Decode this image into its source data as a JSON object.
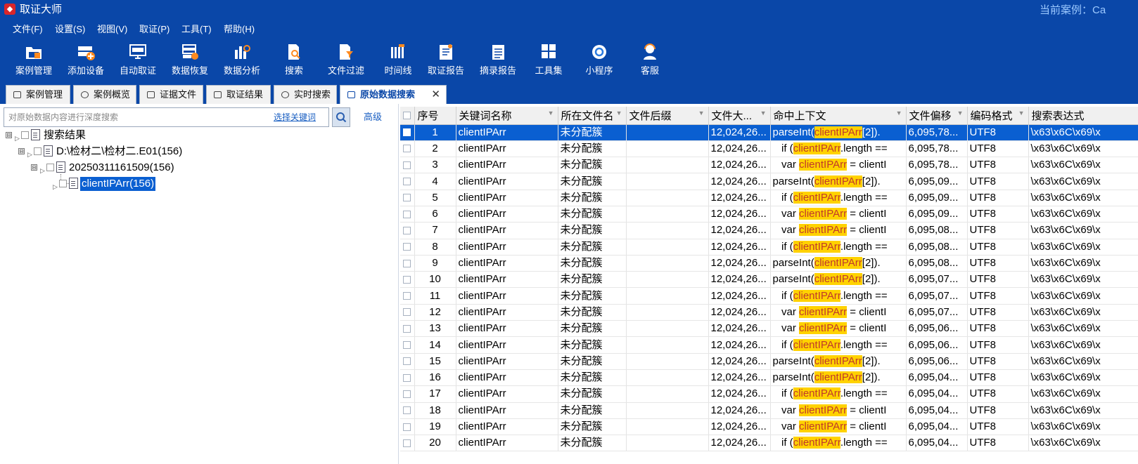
{
  "app": {
    "title": "取证大师",
    "logo": "◆",
    "case_label": "当前案例：Ca"
  },
  "menu": [
    "文件(F)",
    "设置(S)",
    "视图(V)",
    "取证(P)",
    "工具(T)",
    "帮助(H)"
  ],
  "toolbar": [
    {
      "label": "案例管理",
      "icon": "folder-case-icon"
    },
    {
      "label": "添加设备",
      "icon": "add-device-icon"
    },
    {
      "label": "自动取证",
      "icon": "auto-monitor-icon"
    },
    {
      "label": "数据恢复",
      "icon": "data-recovery-icon"
    },
    {
      "label": "数据分析",
      "icon": "data-analysis-icon"
    },
    {
      "label": "搜索",
      "icon": "search-doc-icon"
    },
    {
      "label": "文件过滤",
      "icon": "file-filter-icon"
    },
    {
      "label": "时间线",
      "icon": "timeline-icon"
    },
    {
      "label": "取证报告",
      "icon": "report-icon"
    },
    {
      "label": "摘录报告",
      "icon": "excerpt-report-icon"
    },
    {
      "label": "工具集",
      "icon": "toolset-grid-icon"
    },
    {
      "label": "小程序",
      "icon": "mini-program-icon"
    },
    {
      "label": "客服",
      "icon": "support-agent-icon"
    }
  ],
  "tabs": [
    {
      "label": "案例管理"
    },
    {
      "label": "案例概览"
    },
    {
      "label": "证据文件"
    },
    {
      "label": "取证结果"
    },
    {
      "label": "实时搜索"
    },
    {
      "label": "原始数据搜索",
      "active": true,
      "close": "✕"
    }
  ],
  "search": {
    "placeholder": "对原始数据内容进行深度搜索",
    "keyword_link": "选择关键词",
    "advanced": "高级"
  },
  "tree": [
    {
      "label": "搜索结果",
      "exp": "⊟"
    },
    {
      "label": "D:\\检材二\\检材二.E01(156)",
      "exp": "⊟"
    },
    {
      "label": "20250311161509(156)",
      "exp": "⊟"
    },
    {
      "label": "clientIPArr(156)",
      "selected": true
    }
  ],
  "grid": {
    "columns": [
      "序号",
      "关键词名称",
      "所在文件名",
      "文件后缀",
      "文件大...",
      "命中上下文",
      "文件偏移",
      "编码格式",
      "搜索表达式"
    ],
    "keyword": "clientIPArr",
    "rows": [
      {
        "n": "1",
        "kw": "clientIPArr",
        "file": "未分配簇",
        "ext": "",
        "size": "12,024,26...",
        "pre": "parseInt(",
        "post": "[2]).",
        "off": "6,095,78...",
        "enc": "UTF8",
        "expr": "\\x63\\x6C\\x69\\x"
      },
      {
        "n": "2",
        "kw": "clientIPArr",
        "file": "未分配簇",
        "ext": "",
        "size": "12,024,26...",
        "pre": "   if (",
        "post": ".length ==",
        "off": "6,095,78...",
        "enc": "UTF8",
        "expr": "\\x63\\x6C\\x69\\x"
      },
      {
        "n": "3",
        "kw": "clientIPArr",
        "file": "未分配簇",
        "ext": "",
        "size": "12,024,26...",
        "pre": "   var ",
        "post": " = clientI",
        "off": "6,095,78...",
        "enc": "UTF8",
        "expr": "\\x63\\x6C\\x69\\x"
      },
      {
        "n": "4",
        "kw": "clientIPArr",
        "file": "未分配簇",
        "ext": "",
        "size": "12,024,26...",
        "pre": "parseInt(",
        "post": "[2]).",
        "off": "6,095,09...",
        "enc": "UTF8",
        "expr": "\\x63\\x6C\\x69\\x"
      },
      {
        "n": "5",
        "kw": "clientIPArr",
        "file": "未分配簇",
        "ext": "",
        "size": "12,024,26...",
        "pre": "   if (",
        "post": ".length ==",
        "off": "6,095,09...",
        "enc": "UTF8",
        "expr": "\\x63\\x6C\\x69\\x"
      },
      {
        "n": "6",
        "kw": "clientIPArr",
        "file": "未分配簇",
        "ext": "",
        "size": "12,024,26...",
        "pre": "   var ",
        "post": " = clientI",
        "off": "6,095,09...",
        "enc": "UTF8",
        "expr": "\\x63\\x6C\\x69\\x"
      },
      {
        "n": "7",
        "kw": "clientIPArr",
        "file": "未分配簇",
        "ext": "",
        "size": "12,024,26...",
        "pre": "   var ",
        "post": " = clientI",
        "off": "6,095,08...",
        "enc": "UTF8",
        "expr": "\\x63\\x6C\\x69\\x"
      },
      {
        "n": "8",
        "kw": "clientIPArr",
        "file": "未分配簇",
        "ext": "",
        "size": "12,024,26...",
        "pre": "   if (",
        "post": ".length ==",
        "off": "6,095,08...",
        "enc": "UTF8",
        "expr": "\\x63\\x6C\\x69\\x"
      },
      {
        "n": "9",
        "kw": "clientIPArr",
        "file": "未分配簇",
        "ext": "",
        "size": "12,024,26...",
        "pre": "parseInt(",
        "post": "[2]).",
        "off": "6,095,08...",
        "enc": "UTF8",
        "expr": "\\x63\\x6C\\x69\\x"
      },
      {
        "n": "10",
        "kw": "clientIPArr",
        "file": "未分配簇",
        "ext": "",
        "size": "12,024,26...",
        "pre": "parseInt(",
        "post": "[2]).",
        "off": "6,095,07...",
        "enc": "UTF8",
        "expr": "\\x63\\x6C\\x69\\x"
      },
      {
        "n": "11",
        "kw": "clientIPArr",
        "file": "未分配簇",
        "ext": "",
        "size": "12,024,26...",
        "pre": "   if (",
        "post": ".length ==",
        "off": "6,095,07...",
        "enc": "UTF8",
        "expr": "\\x63\\x6C\\x69\\x"
      },
      {
        "n": "12",
        "kw": "clientIPArr",
        "file": "未分配簇",
        "ext": "",
        "size": "12,024,26...",
        "pre": "   var ",
        "post": " = clientI",
        "off": "6,095,07...",
        "enc": "UTF8",
        "expr": "\\x63\\x6C\\x69\\x"
      },
      {
        "n": "13",
        "kw": "clientIPArr",
        "file": "未分配簇",
        "ext": "",
        "size": "12,024,26...",
        "pre": "   var ",
        "post": " = clientI",
        "off": "6,095,06...",
        "enc": "UTF8",
        "expr": "\\x63\\x6C\\x69\\x"
      },
      {
        "n": "14",
        "kw": "clientIPArr",
        "file": "未分配簇",
        "ext": "",
        "size": "12,024,26...",
        "pre": "   if (",
        "post": ".length ==",
        "off": "6,095,06...",
        "enc": "UTF8",
        "expr": "\\x63\\x6C\\x69\\x"
      },
      {
        "n": "15",
        "kw": "clientIPArr",
        "file": "未分配簇",
        "ext": "",
        "size": "12,024,26...",
        "pre": "parseInt(",
        "post": "[2]).",
        "off": "6,095,06...",
        "enc": "UTF8",
        "expr": "\\x63\\x6C\\x69\\x"
      },
      {
        "n": "16",
        "kw": "clientIPArr",
        "file": "未分配簇",
        "ext": "",
        "size": "12,024,26...",
        "pre": "parseInt(",
        "post": "[2]).",
        "off": "6,095,04...",
        "enc": "UTF8",
        "expr": "\\x63\\x6C\\x69\\x"
      },
      {
        "n": "17",
        "kw": "clientIPArr",
        "file": "未分配簇",
        "ext": "",
        "size": "12,024,26...",
        "pre": "   if (",
        "post": ".length ==",
        "off": "6,095,04...",
        "enc": "UTF8",
        "expr": "\\x63\\x6C\\x69\\x"
      },
      {
        "n": "18",
        "kw": "clientIPArr",
        "file": "未分配簇",
        "ext": "",
        "size": "12,024,26...",
        "pre": "   var ",
        "post": " = clientI",
        "off": "6,095,04...",
        "enc": "UTF8",
        "expr": "\\x63\\x6C\\x69\\x"
      },
      {
        "n": "19",
        "kw": "clientIPArr",
        "file": "未分配簇",
        "ext": "",
        "size": "12,024,26...",
        "pre": "   var ",
        "post": " = clientI",
        "off": "6,095,04...",
        "enc": "UTF8",
        "expr": "\\x63\\x6C\\x69\\x"
      },
      {
        "n": "20",
        "kw": "clientIPArr",
        "file": "未分配簇",
        "ext": "",
        "size": "12,024,26...",
        "pre": "   if (",
        "post": ".length ==",
        "off": "6,095,04...",
        "enc": "UTF8",
        "expr": "\\x63\\x6C\\x69\\x"
      }
    ]
  },
  "colors": {
    "brand_blue": "#0a47a8",
    "selection": "#0a5fd1",
    "highlight": "#ffd200",
    "highlight_text": "#c0392b"
  }
}
